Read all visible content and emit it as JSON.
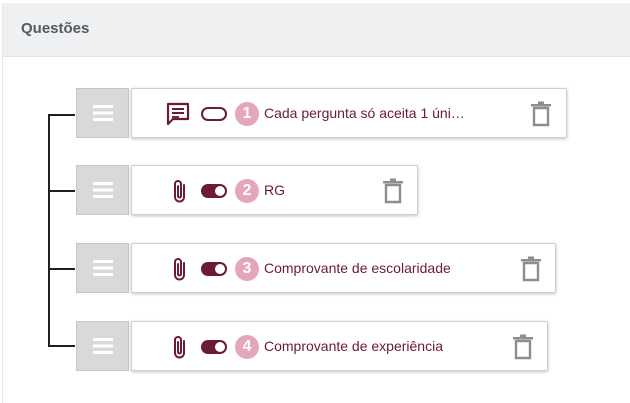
{
  "panel": {
    "title": "Questões"
  },
  "colors": {
    "accent": "#6b1a37",
    "badge": "#e4a6bc",
    "handle_bg": "#d9d9d9",
    "trash": "#8e8e8e"
  },
  "questions": [
    {
      "number": "1",
      "label": "Cada pergunta só aceita 1 úni…",
      "type_icon": "comment-icon",
      "toggle": "off"
    },
    {
      "number": "2",
      "label": "RG",
      "type_icon": "paperclip-icon",
      "toggle": "on"
    },
    {
      "number": "3",
      "label": "Comprovante de escolaridade",
      "type_icon": "paperclip-icon",
      "toggle": "on"
    },
    {
      "number": "4",
      "label": "Comprovante de experiência",
      "type_icon": "paperclip-icon",
      "toggle": "on"
    }
  ]
}
